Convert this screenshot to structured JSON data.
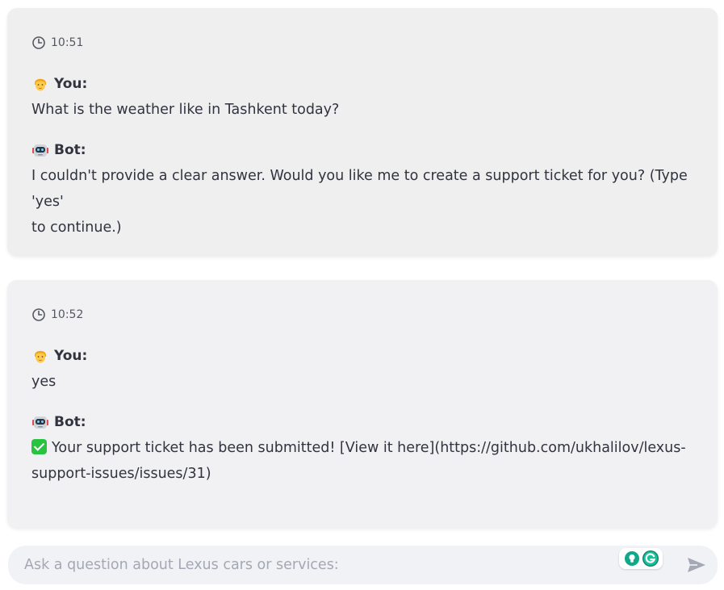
{
  "conversation": [
    {
      "timestamp": "10:51",
      "user_label": "You:",
      "user_message": "What is the weather like in Tashkent today?",
      "bot_label": "Bot:",
      "bot_message_line1": "I couldn't provide a clear answer. Would you like me to create a support ticket for you? (Type 'yes'",
      "bot_message_line2": "to continue.)"
    },
    {
      "timestamp": "10:52",
      "user_label": "You:",
      "user_message": "yes",
      "bot_label": "Bot:",
      "bot_message_line1": "Your support ticket has been submitted! [View it here](https://github.com/ukhalilov/lexus-",
      "bot_message_line2": "support-issues/issues/31)"
    }
  ],
  "chat_input": {
    "placeholder": "Ask a question about Lexus cars or services:",
    "value": ""
  },
  "icons": {
    "timestamp": "clock-icon",
    "user_avatar": "person-emoji-icon",
    "bot_avatar": "robot-emoji-icon",
    "success": "check-mark-icon",
    "extension_1": "lightbulb-icon",
    "extension_2": "grammarly-icon",
    "send": "send-icon"
  },
  "colors": {
    "card_background": "#f0f0f1",
    "input_background": "#f0f2f6",
    "check_green": "#28c43f",
    "grammarly_green": "#15c39a"
  }
}
